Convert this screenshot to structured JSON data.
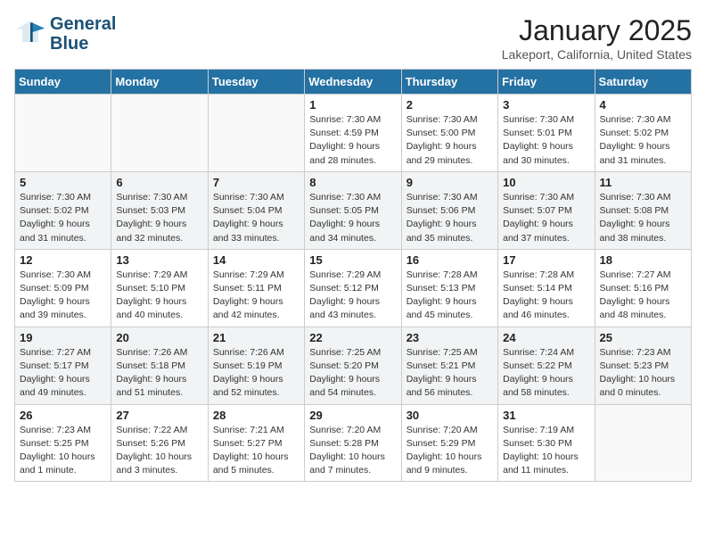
{
  "header": {
    "logo_line1": "General",
    "logo_line2": "Blue",
    "month": "January 2025",
    "location": "Lakeport, California, United States"
  },
  "weekdays": [
    "Sunday",
    "Monday",
    "Tuesday",
    "Wednesday",
    "Thursday",
    "Friday",
    "Saturday"
  ],
  "weeks": [
    [
      {
        "day": "",
        "info": ""
      },
      {
        "day": "",
        "info": ""
      },
      {
        "day": "",
        "info": ""
      },
      {
        "day": "1",
        "info": "Sunrise: 7:30 AM\nSunset: 4:59 PM\nDaylight: 9 hours\nand 28 minutes."
      },
      {
        "day": "2",
        "info": "Sunrise: 7:30 AM\nSunset: 5:00 PM\nDaylight: 9 hours\nand 29 minutes."
      },
      {
        "day": "3",
        "info": "Sunrise: 7:30 AM\nSunset: 5:01 PM\nDaylight: 9 hours\nand 30 minutes."
      },
      {
        "day": "4",
        "info": "Sunrise: 7:30 AM\nSunset: 5:02 PM\nDaylight: 9 hours\nand 31 minutes."
      }
    ],
    [
      {
        "day": "5",
        "info": "Sunrise: 7:30 AM\nSunset: 5:02 PM\nDaylight: 9 hours\nand 31 minutes."
      },
      {
        "day": "6",
        "info": "Sunrise: 7:30 AM\nSunset: 5:03 PM\nDaylight: 9 hours\nand 32 minutes."
      },
      {
        "day": "7",
        "info": "Sunrise: 7:30 AM\nSunset: 5:04 PM\nDaylight: 9 hours\nand 33 minutes."
      },
      {
        "day": "8",
        "info": "Sunrise: 7:30 AM\nSunset: 5:05 PM\nDaylight: 9 hours\nand 34 minutes."
      },
      {
        "day": "9",
        "info": "Sunrise: 7:30 AM\nSunset: 5:06 PM\nDaylight: 9 hours\nand 35 minutes."
      },
      {
        "day": "10",
        "info": "Sunrise: 7:30 AM\nSunset: 5:07 PM\nDaylight: 9 hours\nand 37 minutes."
      },
      {
        "day": "11",
        "info": "Sunrise: 7:30 AM\nSunset: 5:08 PM\nDaylight: 9 hours\nand 38 minutes."
      }
    ],
    [
      {
        "day": "12",
        "info": "Sunrise: 7:30 AM\nSunset: 5:09 PM\nDaylight: 9 hours\nand 39 minutes."
      },
      {
        "day": "13",
        "info": "Sunrise: 7:29 AM\nSunset: 5:10 PM\nDaylight: 9 hours\nand 40 minutes."
      },
      {
        "day": "14",
        "info": "Sunrise: 7:29 AM\nSunset: 5:11 PM\nDaylight: 9 hours\nand 42 minutes."
      },
      {
        "day": "15",
        "info": "Sunrise: 7:29 AM\nSunset: 5:12 PM\nDaylight: 9 hours\nand 43 minutes."
      },
      {
        "day": "16",
        "info": "Sunrise: 7:28 AM\nSunset: 5:13 PM\nDaylight: 9 hours\nand 45 minutes."
      },
      {
        "day": "17",
        "info": "Sunrise: 7:28 AM\nSunset: 5:14 PM\nDaylight: 9 hours\nand 46 minutes."
      },
      {
        "day": "18",
        "info": "Sunrise: 7:27 AM\nSunset: 5:16 PM\nDaylight: 9 hours\nand 48 minutes."
      }
    ],
    [
      {
        "day": "19",
        "info": "Sunrise: 7:27 AM\nSunset: 5:17 PM\nDaylight: 9 hours\nand 49 minutes."
      },
      {
        "day": "20",
        "info": "Sunrise: 7:26 AM\nSunset: 5:18 PM\nDaylight: 9 hours\nand 51 minutes."
      },
      {
        "day": "21",
        "info": "Sunrise: 7:26 AM\nSunset: 5:19 PM\nDaylight: 9 hours\nand 52 minutes."
      },
      {
        "day": "22",
        "info": "Sunrise: 7:25 AM\nSunset: 5:20 PM\nDaylight: 9 hours\nand 54 minutes."
      },
      {
        "day": "23",
        "info": "Sunrise: 7:25 AM\nSunset: 5:21 PM\nDaylight: 9 hours\nand 56 minutes."
      },
      {
        "day": "24",
        "info": "Sunrise: 7:24 AM\nSunset: 5:22 PM\nDaylight: 9 hours\nand 58 minutes."
      },
      {
        "day": "25",
        "info": "Sunrise: 7:23 AM\nSunset: 5:23 PM\nDaylight: 10 hours\nand 0 minutes."
      }
    ],
    [
      {
        "day": "26",
        "info": "Sunrise: 7:23 AM\nSunset: 5:25 PM\nDaylight: 10 hours\nand 1 minute."
      },
      {
        "day": "27",
        "info": "Sunrise: 7:22 AM\nSunset: 5:26 PM\nDaylight: 10 hours\nand 3 minutes."
      },
      {
        "day": "28",
        "info": "Sunrise: 7:21 AM\nSunset: 5:27 PM\nDaylight: 10 hours\nand 5 minutes."
      },
      {
        "day": "29",
        "info": "Sunrise: 7:20 AM\nSunset: 5:28 PM\nDaylight: 10 hours\nand 7 minutes."
      },
      {
        "day": "30",
        "info": "Sunrise: 7:20 AM\nSunset: 5:29 PM\nDaylight: 10 hours\nand 9 minutes."
      },
      {
        "day": "31",
        "info": "Sunrise: 7:19 AM\nSunset: 5:30 PM\nDaylight: 10 hours\nand 11 minutes."
      },
      {
        "day": "",
        "info": ""
      }
    ]
  ]
}
